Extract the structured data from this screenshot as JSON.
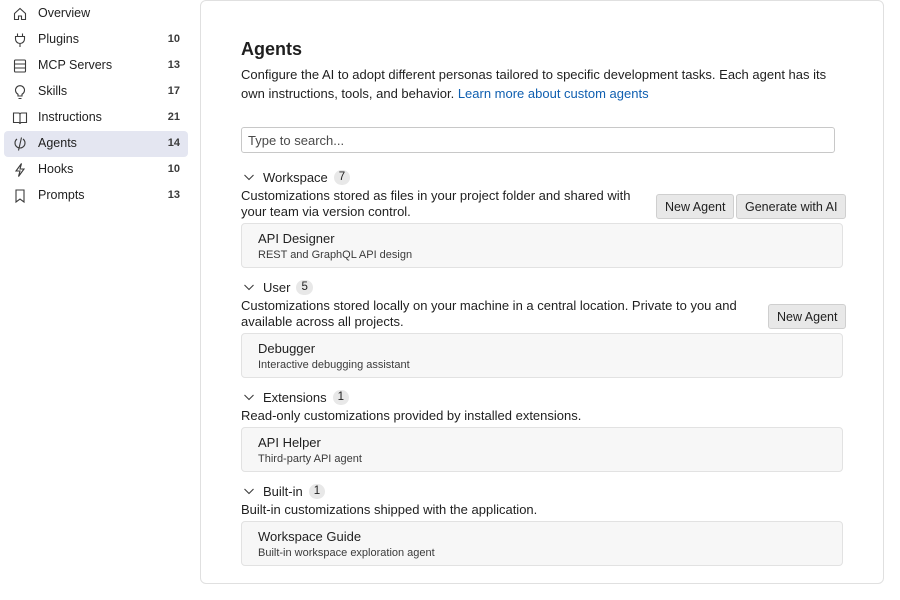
{
  "sidebar": {
    "items": [
      {
        "label": "Overview",
        "count": "",
        "icon": "home-icon",
        "active": false
      },
      {
        "label": "Plugins",
        "count": "10",
        "icon": "plug-icon",
        "active": false
      },
      {
        "label": "MCP Servers",
        "count": "13",
        "icon": "server-icon",
        "active": false
      },
      {
        "label": "Skills",
        "count": "17",
        "icon": "lightbulb-icon",
        "active": false
      },
      {
        "label": "Instructions",
        "count": "21",
        "icon": "book-icon",
        "active": false
      },
      {
        "label": "Agents",
        "count": "14",
        "icon": "agent-icon",
        "active": true
      },
      {
        "label": "Hooks",
        "count": "10",
        "icon": "lightning-icon",
        "active": false
      },
      {
        "label": "Prompts",
        "count": "13",
        "icon": "bookmark-icon",
        "active": false
      }
    ]
  },
  "main": {
    "title": "Agents",
    "description": "Configure the AI to adopt different personas tailored to specific development tasks. Each agent has its own instructions, tools, and behavior.",
    "learn_more": "Learn more about custom agents",
    "search": {
      "placeholder": "Type to search...",
      "value": ""
    },
    "sections": [
      {
        "name": "Workspace",
        "count": "7",
        "description": "Customizations stored as files in your project folder and shared with your team via version control.",
        "buttons": [
          "New Agent",
          "Generate with AI"
        ],
        "items": [
          {
            "name": "API Designer",
            "description": "REST and GraphQL API design"
          }
        ]
      },
      {
        "name": "User",
        "count": "5",
        "description": "Customizations stored locally on your machine in a central location. Private to you and available across all projects.",
        "buttons": [
          "New Agent"
        ],
        "items": [
          {
            "name": "Debugger",
            "description": "Interactive debugging assistant"
          }
        ]
      },
      {
        "name": "Extensions",
        "count": "1",
        "description": "Read-only customizations provided by installed extensions.",
        "buttons": [],
        "items": [
          {
            "name": "API Helper",
            "description": "Third-party API agent"
          }
        ]
      },
      {
        "name": "Built-in",
        "count": "1",
        "description": "Built-in customizations shipped with the application.",
        "buttons": [],
        "items": [
          {
            "name": "Workspace Guide",
            "description": "Built-in workspace exploration agent"
          }
        ]
      }
    ]
  },
  "colors": {
    "accent": "#0f5fb0",
    "active_bg": "#e4e6f1"
  }
}
